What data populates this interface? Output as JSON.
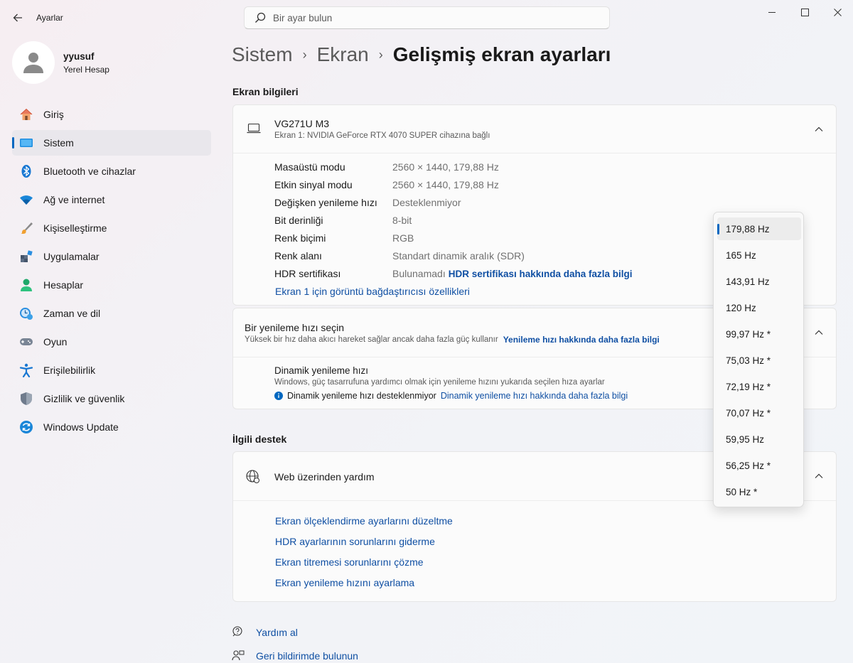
{
  "window": {
    "app_title": "Ayarlar",
    "search_placeholder": "Bir ayar bulun"
  },
  "profile": {
    "name": "yyusuf",
    "account_type": "Yerel Hesap"
  },
  "sidebar": {
    "items": [
      {
        "label": "Giriş",
        "icon": "home-icon"
      },
      {
        "label": "Sistem",
        "icon": "system-icon",
        "active": true
      },
      {
        "label": "Bluetooth ve cihazlar",
        "icon": "bluetooth-icon"
      },
      {
        "label": "Ağ ve internet",
        "icon": "wifi-icon"
      },
      {
        "label": "Kişiselleştirme",
        "icon": "brush-icon"
      },
      {
        "label": "Uygulamalar",
        "icon": "apps-icon"
      },
      {
        "label": "Hesaplar",
        "icon": "accounts-icon"
      },
      {
        "label": "Zaman ve dil",
        "icon": "time-language-icon"
      },
      {
        "label": "Oyun",
        "icon": "gaming-icon"
      },
      {
        "label": "Erişilebilirlik",
        "icon": "accessibility-icon"
      },
      {
        "label": "Gizlilik ve güvenlik",
        "icon": "shield-icon"
      },
      {
        "label": "Windows Update",
        "icon": "update-icon"
      }
    ]
  },
  "breadcrumb": {
    "items": [
      "Sistem",
      "Ekran"
    ],
    "current": "Gelişmiş ekran ayarları"
  },
  "display_info": {
    "section_title": "Ekran bilgileri",
    "monitor_name": "VG271U M3",
    "monitor_sub": "Ekran 1: NVIDIA GeForce RTX 4070 SUPER cihazına bağlı",
    "rows": [
      {
        "label": "Masaüstü modu",
        "value": "2560 × 1440, 179,88 Hz"
      },
      {
        "label": "Etkin sinyal modu",
        "value": "2560 × 1440, 179,88 Hz"
      },
      {
        "label": "Değişken yenileme hızı",
        "value": "Desteklenmiyor"
      },
      {
        "label": "Bit derinliği",
        "value": "8-bit"
      },
      {
        "label": "Renk biçimi",
        "value": "RGB"
      },
      {
        "label": "Renk alanı",
        "value": "Standart dinamik aralık (SDR)"
      },
      {
        "label": "HDR sertifikası",
        "value": "Bulunamadı"
      }
    ],
    "hdr_link": "HDR sertifikası hakkında daha fazla bilgi",
    "adapter_link": "Ekran 1 için görüntü bağdaştırıcısı özellikleri"
  },
  "refresh": {
    "title": "Bir yenileme hızı seçin",
    "desc": "Yüksek bir hız daha akıcı hareket sağlar ancak daha fazla güç kullanır",
    "link": "Yenileme hızı hakkında daha fazla bilgi",
    "dynamic_title": "Dinamik yenileme hızı",
    "dynamic_desc": "Windows, güç tasarrufuna yardımcı olmak için yenileme hızını yukarıda seçilen hıza ayarlar",
    "dynamic_unsupported": "Dinamik yenileme hızı desteklenmiyor",
    "dynamic_link": "Dinamik yenileme hızı hakkında daha fazla bilgi",
    "options": [
      "179,88 Hz",
      "165 Hz",
      "143,91 Hz",
      "120 Hz",
      "99,97 Hz *",
      "75,03 Hz *",
      "72,19 Hz *",
      "70,07 Hz *",
      "59,95 Hz",
      "56,25 Hz *",
      "50 Hz *"
    ],
    "selected": "179,88 Hz"
  },
  "support": {
    "section_title": "İlgili destek",
    "web_help_title": "Web üzerinden yardım",
    "links": [
      "Ekran ölçeklendirme ayarlarını düzeltme",
      "HDR ayarlarının sorunlarını giderme",
      "Ekran titremesi sorunlarını çözme",
      "Ekran yenileme hızını ayarlama"
    ]
  },
  "footer": {
    "get_help": "Yardım al",
    "feedback": "Geri bildirimde bulunun"
  },
  "colors": {
    "accent": "#0067c0",
    "link": "#0f4fa3"
  }
}
